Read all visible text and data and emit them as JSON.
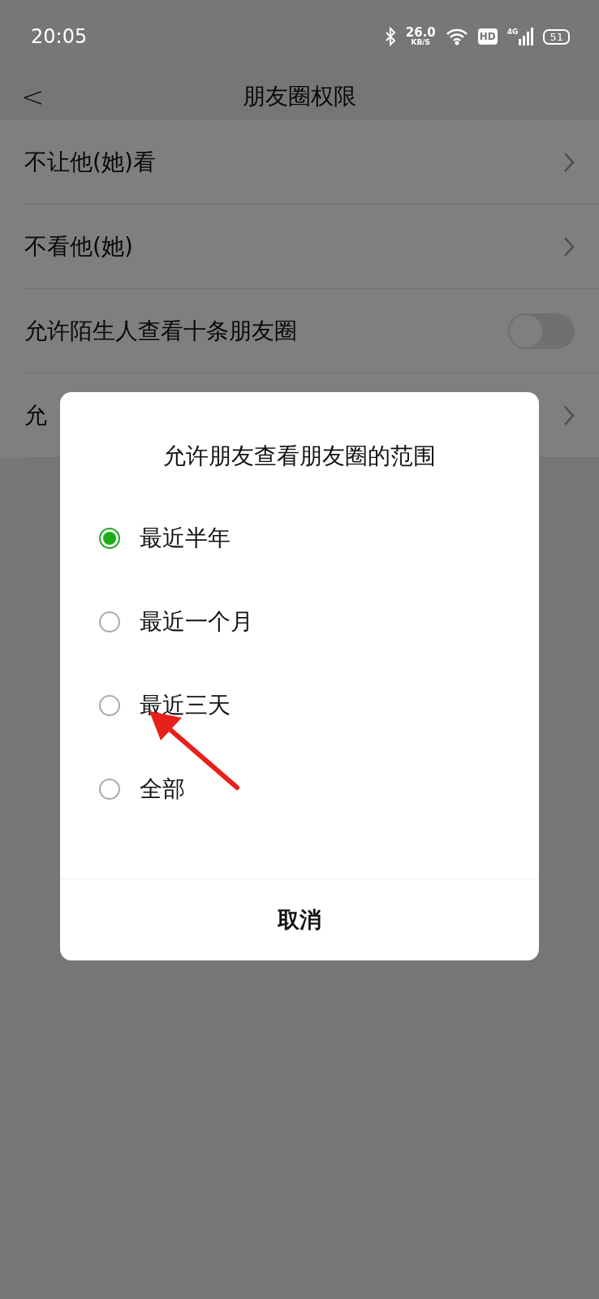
{
  "status_bar": {
    "time": "20:05",
    "speed": "26.0",
    "speed_unit": "KB/S",
    "hd": "HD",
    "network": "4G",
    "battery": "51"
  },
  "header": {
    "back": "<",
    "title": "朋友圈权限"
  },
  "settings": [
    {
      "kind": "link",
      "label": "不让他(她)看"
    },
    {
      "kind": "link",
      "label": "不看他(她)"
    },
    {
      "kind": "toggle",
      "label": "允许陌生人查看十条朋友圈",
      "on": false
    },
    {
      "kind": "link",
      "label": "允"
    }
  ],
  "dialog": {
    "title": "允许朋友查看朋友圈的范围",
    "options": [
      {
        "label": "最近半年",
        "selected": true
      },
      {
        "label": "最近一个月",
        "selected": false
      },
      {
        "label": "最近三天",
        "selected": false
      },
      {
        "label": "全部",
        "selected": false
      }
    ],
    "cancel": "取消"
  }
}
